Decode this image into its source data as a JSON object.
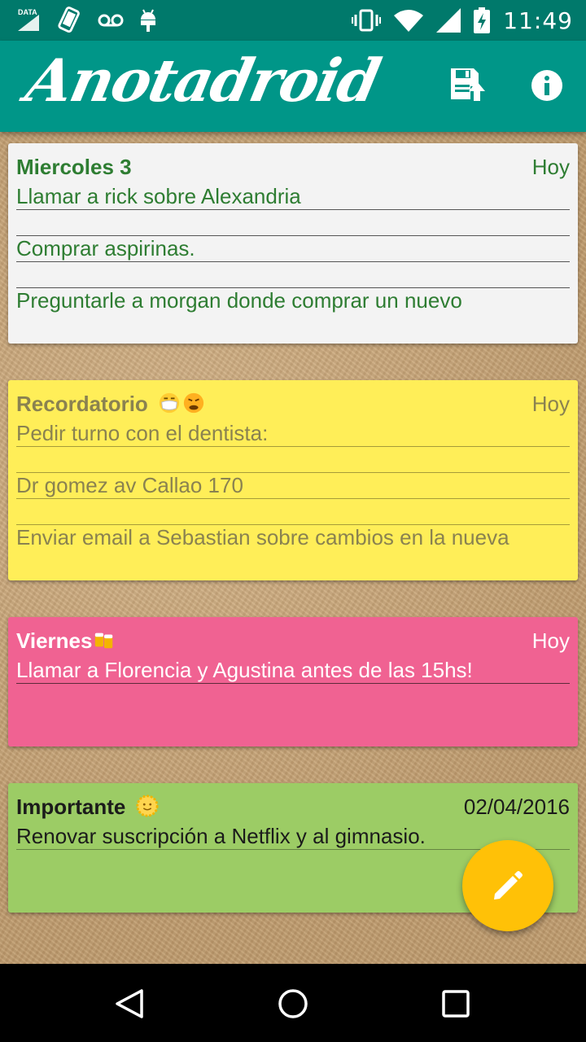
{
  "statusbar": {
    "data_label": "DATA",
    "time": "11:49"
  },
  "appbar": {
    "title": "Anotadroid",
    "save_icon": "save-export-icon",
    "info_icon": "info-icon"
  },
  "notes": [
    {
      "title": "Miercoles 3",
      "date": "Hoy",
      "lines": [
        "Llamar a rick sobre Alexandria",
        "",
        "Comprar aspirinas.",
        "",
        "Preguntarle a morgan donde comprar un nuevo"
      ],
      "color": "#f3f3f3"
    },
    {
      "title": "Recordatorio",
      "emojis": [
        "sick-face-emoji",
        "angry-face-emoji"
      ],
      "date": "Hoy",
      "lines": [
        "Pedir turno con el dentista:",
        "",
        "Dr gomez av Callao 170",
        "",
        "Enviar email a Sebastian sobre cambios en la nueva"
      ],
      "color": "#ffee58"
    },
    {
      "title": "Viernes",
      "emojis": [
        "beer-mugs-emoji"
      ],
      "date": "Hoy",
      "lines": [
        "Llamar a Florencia y Agustina antes de las 15hs!"
      ],
      "color": "#f06292"
    },
    {
      "title": "Importante",
      "emojis": [
        "sun-face-emoji"
      ],
      "date": "02/04/2016",
      "lines": [
        "Renovar suscripción a Netflix y al gimnasio."
      ],
      "color": "#9ccc65"
    }
  ],
  "fab": {
    "icon": "pencil-icon",
    "color": "#ffc107"
  },
  "navbar": {
    "back": "back-icon",
    "home": "home-icon",
    "recents": "recents-icon"
  }
}
